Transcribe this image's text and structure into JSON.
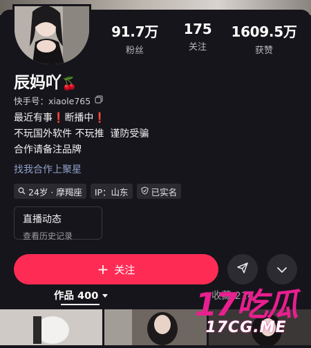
{
  "profile": {
    "name": "辰妈吖",
    "name_emoji": "🍒",
    "kuaishou_id": "快手号：xiaole765",
    "bio_line1_a": "最近有事",
    "bio_line1_b": "断播中",
    "bio_mark": "❗",
    "bio_line2": "不玩国外软件 不玩推  谨防受骗",
    "bio_line3": "合作请备注品牌",
    "collab_link": "找我合作上聚星"
  },
  "stats": [
    {
      "value": "91.7万",
      "label": "粉丝"
    },
    {
      "value": "175",
      "label": "关注"
    },
    {
      "value": "1609.5万",
      "label": "获赞"
    }
  ],
  "tags": {
    "age_zodiac": "24岁 · 摩羯座",
    "ip": "IP：山东",
    "verified": "已实名"
  },
  "live_card": {
    "title": "直播动态",
    "subtitle": "查看历史记录"
  },
  "actions": {
    "follow_label": "关注",
    "follow_plus": "+"
  },
  "tabs": {
    "works": "作品 400",
    "favorites": "收藏 214"
  },
  "watermark": {
    "big": "17吃瓜",
    "small": "17CG.ME"
  },
  "colors": {
    "background": "#16151b",
    "follow_button": "#fe2c55",
    "link": "#8fa0c8",
    "watermark": "#e81f8f"
  }
}
